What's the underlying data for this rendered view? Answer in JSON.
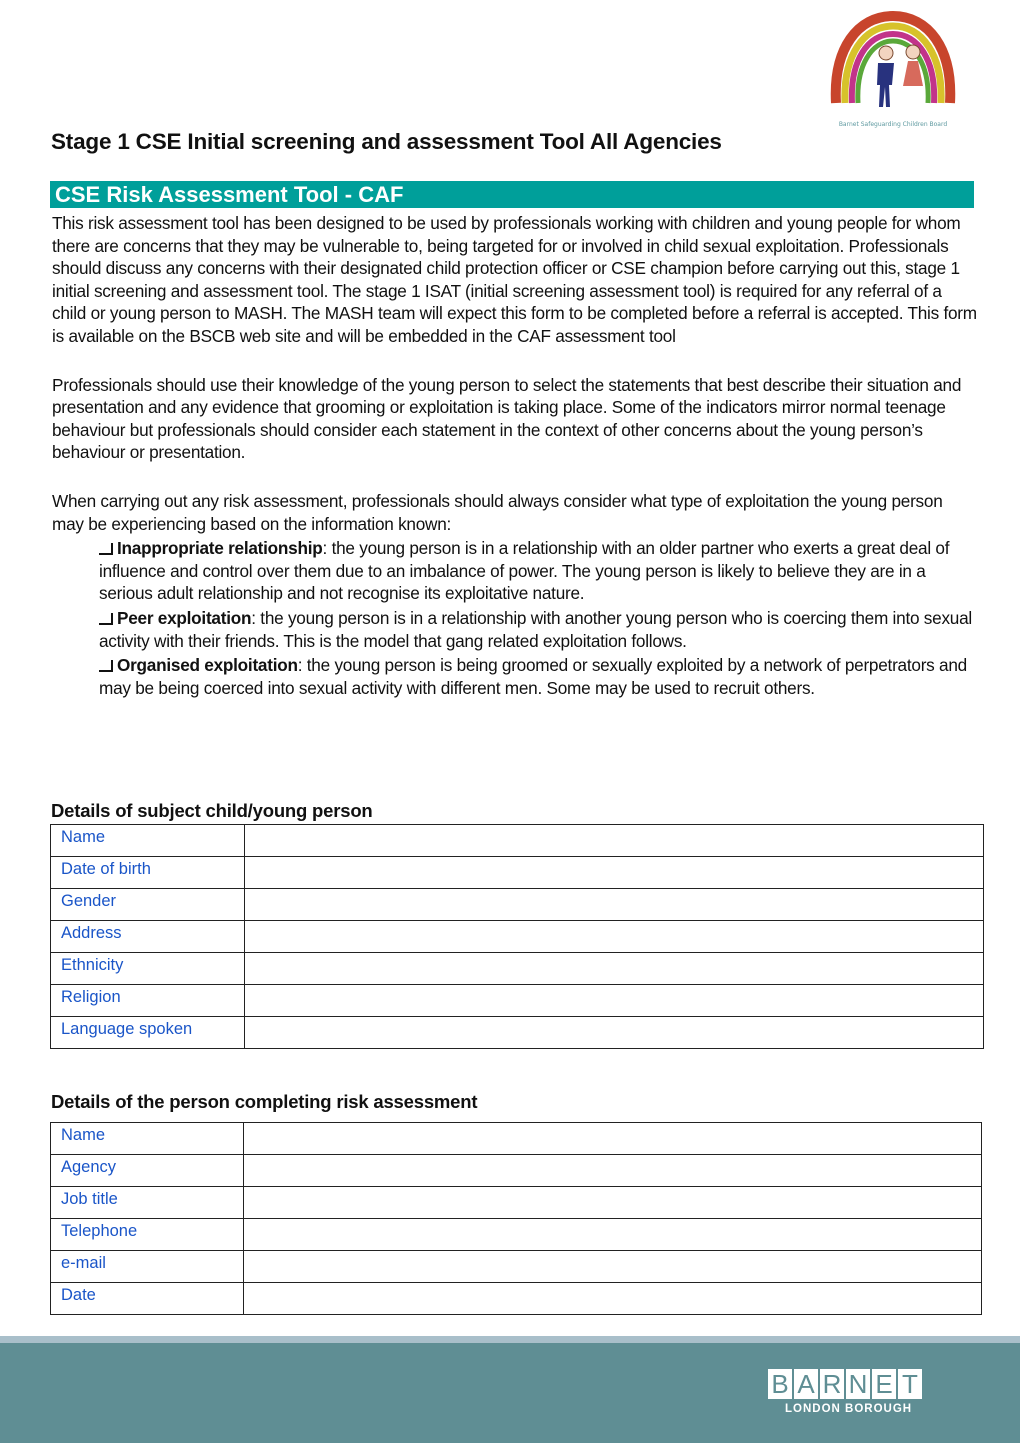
{
  "logo": {
    "text": "Barnet Safeguarding Children Board"
  },
  "title": "Stage 1 CSE Initial screening and assessment Tool All Agencies",
  "banner": "CSE Risk Assessment Tool - CAF",
  "intro": [
    "This risk assessment tool has been designed to be used by professionals working with children and young people for whom there are concerns that they may be vulnerable to, being targeted for or involved in child sexual exploitation. Professionals should discuss any concerns with their designated child protection officer or CSE champion before carrying out this, stage 1 initial screening and assessment tool. The stage 1 ISAT (initial screening assessment tool) is required for any referral of a child or young person to MASH. The MASH team will expect this form to be completed before a referral is accepted. This form is available on the BSCB web site and will be embedded in the CAF assessment tool",
    "Professionals should use their knowledge of the young person to select the statements that best describe their situation and presentation and any evidence that grooming or exploitation is taking place. Some of the indicators mirror normal teenage behaviour but professionals should consider each statement in the context of other concerns about the young person’s behaviour or presentation.",
    "When carrying out any risk assessment, professionals should always consider what type of exploitation the young person may be experiencing based on the information known:"
  ],
  "types": [
    {
      "label": "Inappropriate relationship",
      "text": ": the young person is in a relationship with an older partner who exerts a great deal of influence and control over them due to an imbalance of power. The young person is likely to believe they are in a serious adult relationship and not recognise its exploitative nature.",
      "checked": false
    },
    {
      "label": "Peer exploitation",
      "text": ": the young person is in a relationship with another young person who is coercing them into sexual activity with their friends. This is the model that gang related exploitation follows.",
      "checked": false
    },
    {
      "label": "Organised exploitation",
      "text": ": the young person is being groomed or sexually exploited by a network of perpetrators and may be being coerced into sexual activity with different men. Some may be used to recruit others.",
      "checked": false
    }
  ],
  "subject": {
    "heading": "Details of subject child/young person",
    "fields": [
      {
        "label": "Name",
        "value": ""
      },
      {
        "label": "Date of birth",
        "value": ""
      },
      {
        "label": "Gender",
        "value": ""
      },
      {
        "label": "Address",
        "value": ""
      },
      {
        "label": "Ethnicity",
        "value": ""
      },
      {
        "label": "Religion",
        "value": ""
      },
      {
        "label": "Language spoken",
        "value": ""
      }
    ]
  },
  "assessor": {
    "heading": "Details of the person completing risk assessment",
    "fields": [
      {
        "label": "Name",
        "value": ""
      },
      {
        "label": "Agency",
        "value": ""
      },
      {
        "label": "Job title",
        "value": ""
      },
      {
        "label": "Telephone",
        "value": ""
      },
      {
        "label": "e-mail",
        "value": ""
      },
      {
        "label": "Date",
        "value": ""
      }
    ]
  },
  "footer": {
    "brand_letters": [
      "B",
      "A",
      "R",
      "N",
      "E",
      "T"
    ],
    "subtitle": "LONDON BOROUGH"
  },
  "colors": {
    "banner": "#009f9a",
    "footer": "#5f8e94",
    "field_label": "#1a55c8"
  }
}
